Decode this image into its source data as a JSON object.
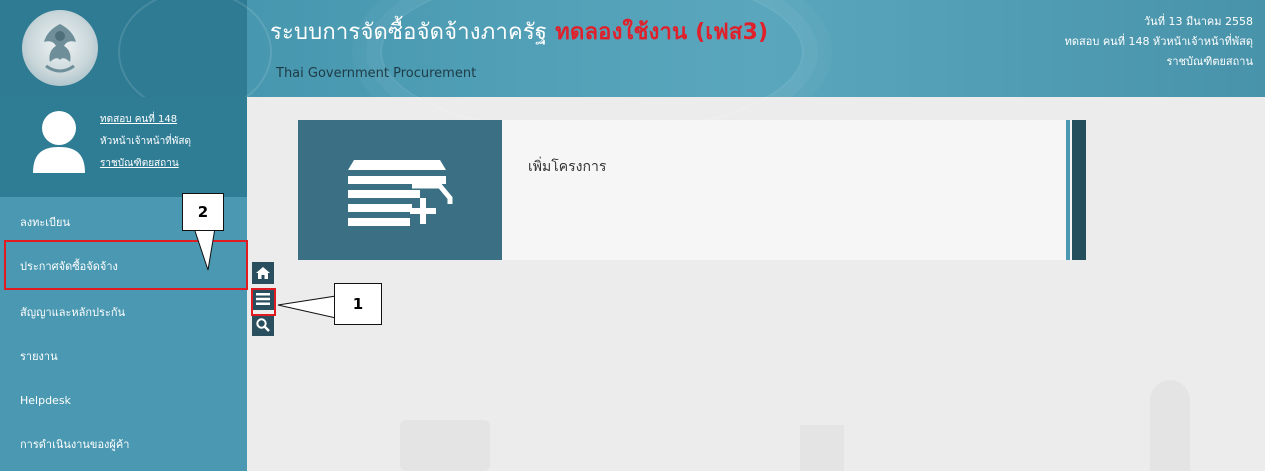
{
  "header": {
    "title_main": "ระบบการจัดซื้อจัดจ้างภาครัฐ",
    "title_trial": "ทดลองใช้งาน (เฟส3)",
    "subtitle": "Thai Government Procurement",
    "date": "วันที่ 13 มีนาคม 2558",
    "user_role": "ทดสอบ คนที่ 148  หัวหน้าเจ้าหน้าที่พัสดุ",
    "org": "ราชบัณฑิตยสถาน"
  },
  "profile": {
    "name": "ทดสอบ คนที่ 148",
    "role": "หัวหน้าเจ้าหน้าที่พัสดุ",
    "org": "ราชบัณฑิตยสถาน"
  },
  "sidebar": {
    "items": [
      {
        "label": "ลงทะเบียน"
      },
      {
        "label": "ประกาศจัดซื้อจัดจ้าง"
      },
      {
        "label": "สัญญาและหลักประกัน"
      },
      {
        "label": "รายงาน"
      },
      {
        "label": "Helpdesk"
      },
      {
        "label": "การดำเนินงานของผู้ค้า"
      }
    ]
  },
  "toolbar": {
    "icons": [
      "home-icon",
      "menu-icon",
      "search-icon"
    ]
  },
  "main": {
    "card_label": "เพิ่มโครงการ",
    "card_icon": "add-project-icon"
  },
  "annotations": {
    "callout_1": "1",
    "callout_2": "2"
  },
  "colors": {
    "header": "#4b9bb3",
    "sidebar": "#4a98b1",
    "profile": "#2f7d95",
    "tile": "#3a6f84",
    "highlight": "#e01b22",
    "trial_text": "#e0202a"
  }
}
